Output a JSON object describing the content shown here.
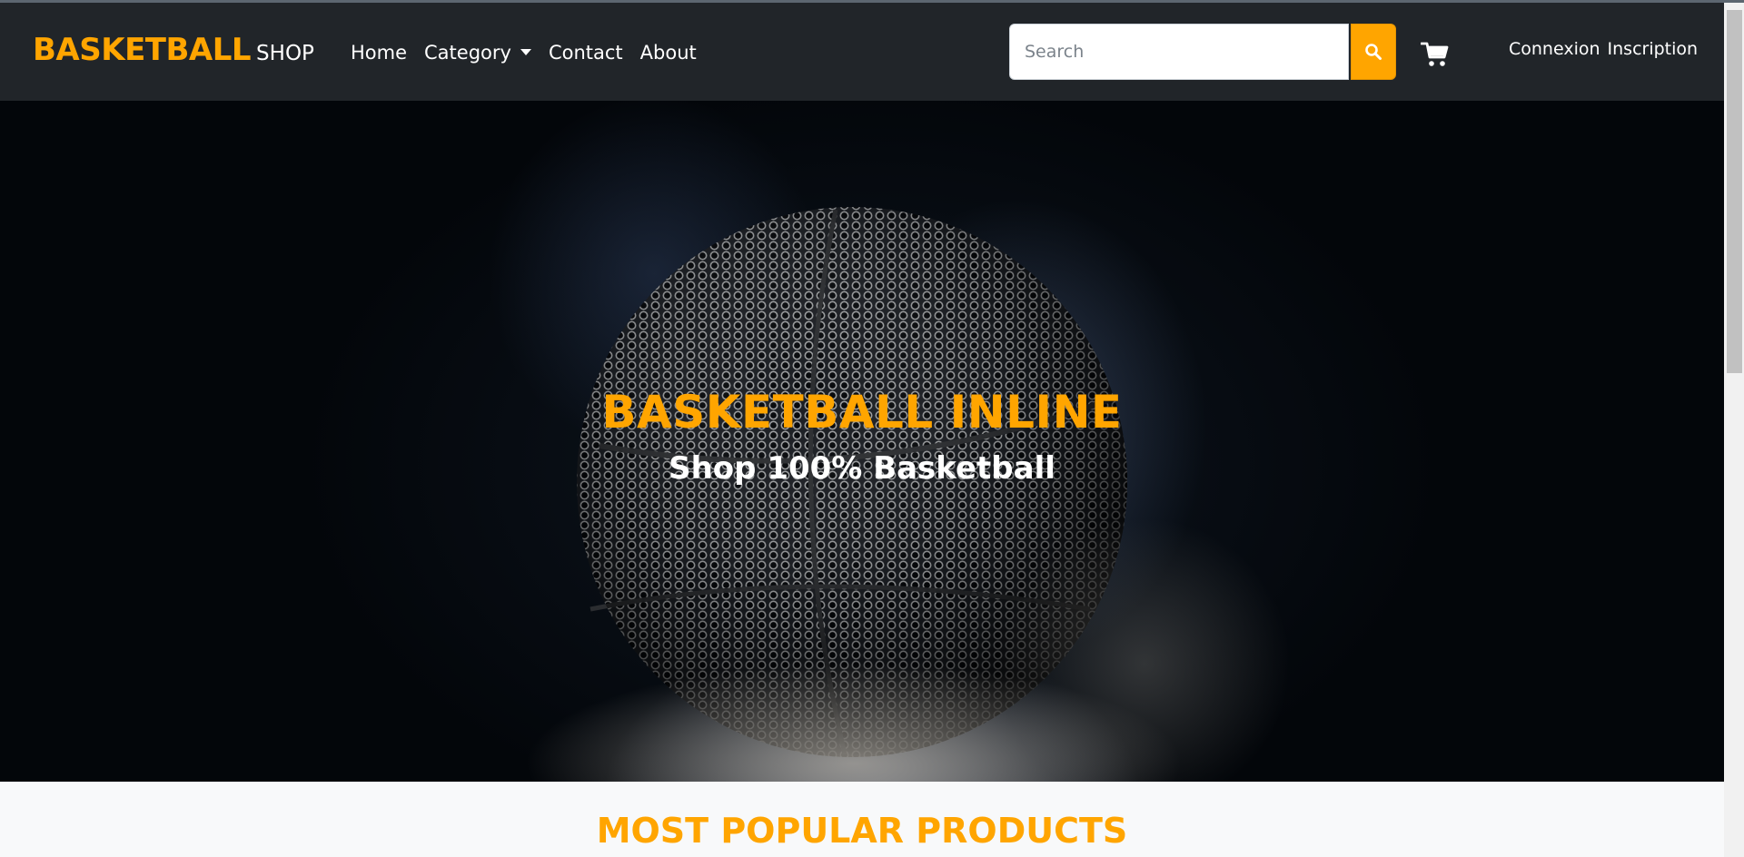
{
  "brand": {
    "main": "BASKETBALL",
    "sub": "SHOP"
  },
  "nav": {
    "items": [
      {
        "label": "Home"
      },
      {
        "label": "Category"
      },
      {
        "label": "Contact"
      },
      {
        "label": "About"
      }
    ]
  },
  "search": {
    "placeholder": "Search",
    "value": "",
    "icon": "search-icon"
  },
  "cart": {
    "icon": "cart-icon"
  },
  "auth": {
    "login": "Connexion",
    "register": "Inscription"
  },
  "hero": {
    "title": "BASKETBALL INLINE",
    "subtitle": "Shop 100% Basketball"
  },
  "popular": {
    "title": "MOST POPULAR PRODUCTS"
  },
  "colors": {
    "accent": "#ffa500",
    "navbar": "#212529",
    "page": "#f8f9fa"
  }
}
